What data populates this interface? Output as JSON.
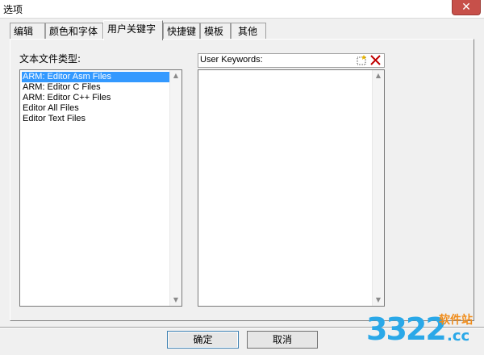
{
  "window": {
    "title": "选项",
    "close_glyph": "✕"
  },
  "tabs": [
    {
      "label": "编辑器",
      "active": false
    },
    {
      "label": "颜色和字体",
      "active": false
    },
    {
      "label": "用户关键字",
      "active": true
    },
    {
      "label": "快捷键",
      "active": false
    },
    {
      "label": "模板",
      "active": false
    },
    {
      "label": "其他",
      "active": false
    }
  ],
  "file_types": {
    "label": "文本文件类型:",
    "items": [
      {
        "label": "ARM: Editor Asm Files",
        "selected": true
      },
      {
        "label": "ARM: Editor C Files",
        "selected": false
      },
      {
        "label": "ARM: Editor C++ Files",
        "selected": false
      },
      {
        "label": "Editor All Files",
        "selected": false
      },
      {
        "label": "Editor Text Files",
        "selected": false
      }
    ]
  },
  "keywords": {
    "label": "User Keywords:",
    "items": [],
    "icons": {
      "new": "new-item-icon",
      "delete": "delete-icon"
    }
  },
  "buttons": {
    "ok": "确定",
    "cancel": "取消"
  },
  "watermark": {
    "digits": "3322",
    "brand": "软件站",
    "suffix": ".cc"
  },
  "colors": {
    "selection": "#3399ff",
    "delete_icon": "#c00000",
    "watermark_blue": "#2aa8e8",
    "watermark_orange": "#f08c1a"
  }
}
